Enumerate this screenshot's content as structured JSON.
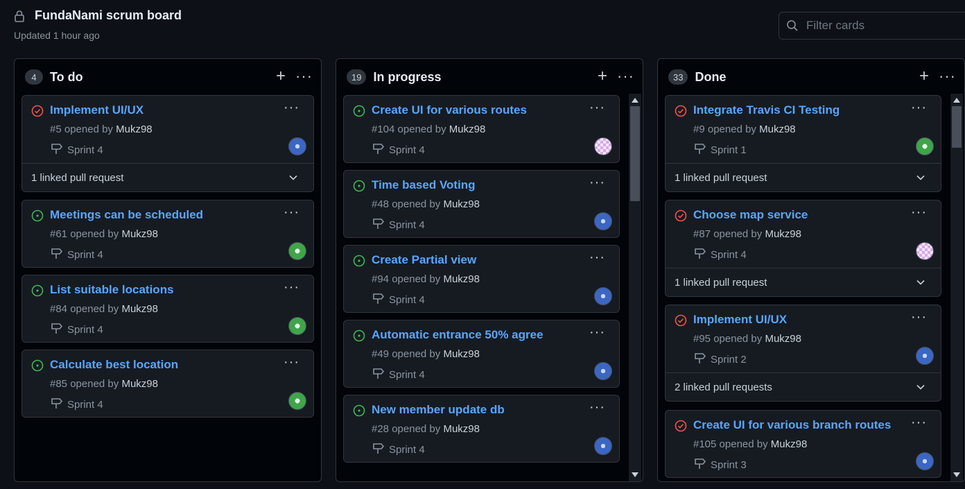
{
  "header": {
    "title": "FundaNami scrum board",
    "updated": "Updated 1 hour ago"
  },
  "filter": {
    "placeholder": "Filter cards"
  },
  "columns": [
    {
      "count": "4",
      "name": "To do",
      "cards": [
        {
          "title": "Implement UI/UX",
          "status": "closed",
          "number": "#5",
          "opened_by": "opened by",
          "author": "Mukz98",
          "milestone": "Sprint 4",
          "avatar": "blue",
          "linked": "1 linked pull request"
        },
        {
          "title": "Meetings can be scheduled",
          "status": "open",
          "number": "#61",
          "opened_by": "opened by",
          "author": "Mukz98",
          "milestone": "Sprint 4",
          "avatar": "green"
        },
        {
          "title": "List suitable locations",
          "status": "open",
          "number": "#84",
          "opened_by": "opened by",
          "author": "Mukz98",
          "milestone": "Sprint 4",
          "avatar": "green"
        },
        {
          "title": "Calculate best location",
          "status": "open",
          "number": "#85",
          "opened_by": "opened by",
          "author": "Mukz98",
          "milestone": "Sprint 4",
          "avatar": "green"
        }
      ]
    },
    {
      "count": "19",
      "name": "In progress",
      "cards": [
        {
          "title": "Create UI for various routes",
          "status": "open",
          "number": "#104",
          "opened_by": "opened by",
          "author": "Mukz98",
          "milestone": "Sprint 4",
          "avatar": "pink"
        },
        {
          "title": "Time based Voting",
          "status": "open",
          "number": "#48",
          "opened_by": "opened by",
          "author": "Mukz98",
          "milestone": "Sprint 4",
          "avatar": "blue"
        },
        {
          "title": "Create Partial view",
          "status": "open",
          "number": "#94",
          "opened_by": "opened by",
          "author": "Mukz98",
          "milestone": "Sprint 4",
          "avatar": "blue"
        },
        {
          "title": "Automatic entrance 50% agree",
          "status": "open",
          "number": "#49",
          "opened_by": "opened by",
          "author": "Mukz98",
          "milestone": "Sprint 4",
          "avatar": "blue"
        },
        {
          "title": "New member update db",
          "status": "open",
          "number": "#28",
          "opened_by": "opened by",
          "author": "Mukz98",
          "milestone": "Sprint 4",
          "avatar": "blue"
        }
      ]
    },
    {
      "count": "33",
      "name": "Done",
      "cards": [
        {
          "title": "Integrate Travis CI Testing",
          "status": "closed",
          "number": "#9",
          "opened_by": "opened by",
          "author": "Mukz98",
          "milestone": "Sprint 1",
          "avatar": "green",
          "linked": "1 linked pull request"
        },
        {
          "title": "Choose map service",
          "status": "closed",
          "number": "#87",
          "opened_by": "opened by",
          "author": "Mukz98",
          "milestone": "Sprint 4",
          "avatar": "pink",
          "linked": "1 linked pull request"
        },
        {
          "title": "Implement UI/UX",
          "status": "closed",
          "number": "#95",
          "opened_by": "opened by",
          "author": "Mukz98",
          "milestone": "Sprint 2",
          "avatar": "blue",
          "linked": "2 linked pull requests"
        },
        {
          "title": "Create UI for various branch routes",
          "status": "closed",
          "number": "#105",
          "opened_by": "opened by",
          "author": "Mukz98",
          "milestone": "Sprint 3",
          "avatar": "blue"
        }
      ]
    }
  ],
  "colors": {
    "open": "#3fb950",
    "closed": "#f85149",
    "link": "#58a6ff"
  }
}
